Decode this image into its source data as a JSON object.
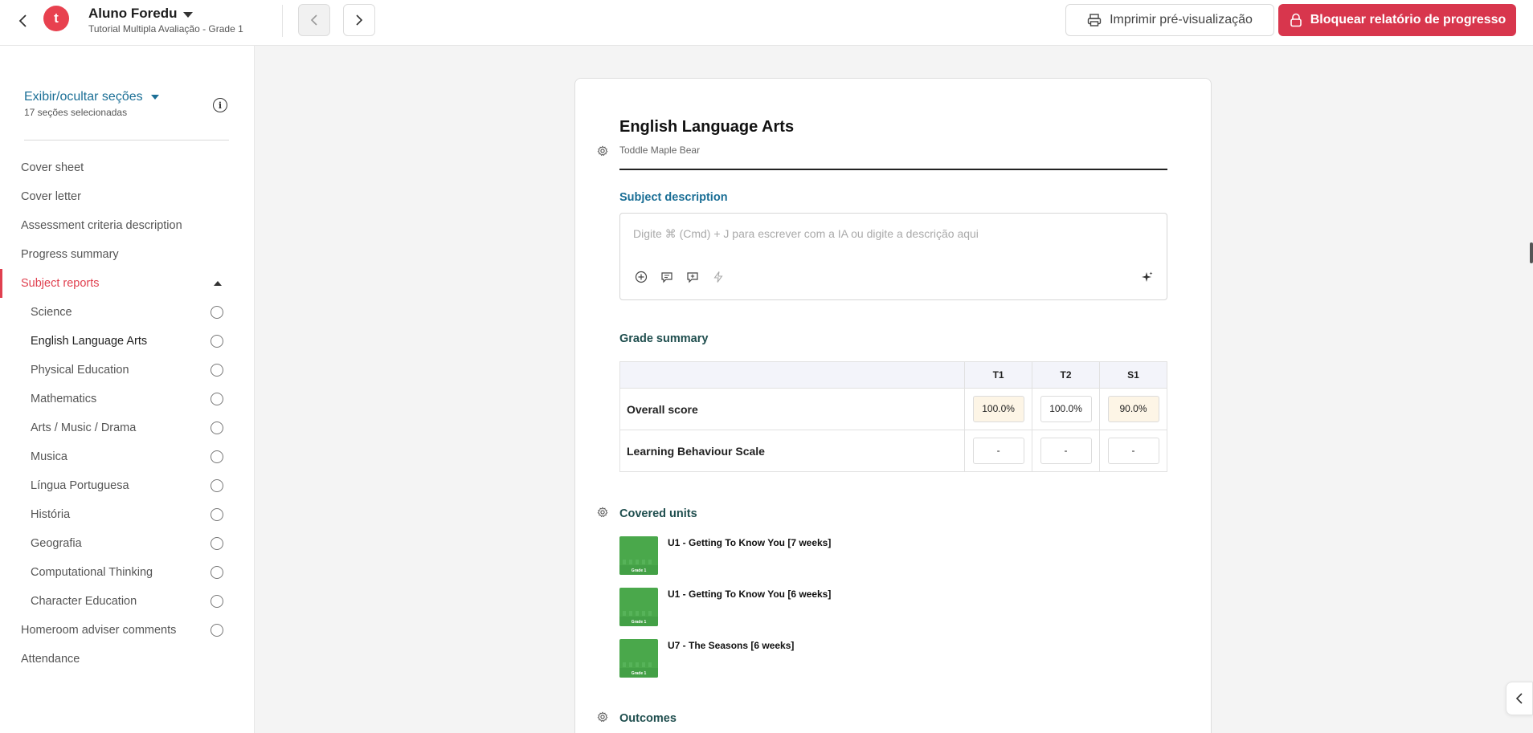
{
  "header": {
    "logo_letter": "t",
    "student_name": "Aluno Foredu",
    "student_subtitle": "Tutorial Multipla Avaliação - Grade 1",
    "print_label": "Imprimir pré-visualização",
    "lock_label": "Bloquear relatório de progresso",
    "accent_color": "#d8364d"
  },
  "sidebar": {
    "toggle_label": "Exibir/ocultar seções",
    "sections_count": "17 seções selecionadas",
    "items": [
      {
        "label": "Cover sheet"
      },
      {
        "label": "Cover letter"
      },
      {
        "label": "Assessment criteria description"
      },
      {
        "label": "Progress summary"
      },
      {
        "label": "Subject reports"
      },
      {
        "label": "Science"
      },
      {
        "label": "English Language Arts"
      },
      {
        "label": "Physical Education"
      },
      {
        "label": "Mathematics"
      },
      {
        "label": "Arts / Music / Drama"
      },
      {
        "label": "Musica"
      },
      {
        "label": "Língua Portuguesa"
      },
      {
        "label": "História"
      },
      {
        "label": "Geografia"
      },
      {
        "label": "Computational Thinking"
      },
      {
        "label": "Character Education"
      },
      {
        "label": "Homeroom adviser comments"
      },
      {
        "label": "Attendance"
      }
    ]
  },
  "report": {
    "subject_title": "English Language Arts",
    "school_name": "Toddle Maple Bear",
    "description_label": "Subject description",
    "description_placeholder": "Digite ⌘ (Cmd) + J para escrever com a IA ou digite a descrição aqui",
    "grade_summary_label": "Grade summary",
    "grade_table": {
      "columns": [
        "T1",
        "T2",
        "S1"
      ],
      "rows": [
        {
          "label": "Overall score",
          "values": [
            "100.0%",
            "100.0%",
            "90.0%"
          ]
        },
        {
          "label": "Learning Behaviour Scale",
          "values": [
            "-",
            "-",
            "-"
          ]
        }
      ]
    },
    "covered_units_label": "Covered units",
    "units": [
      {
        "title": "U1 - Getting To Know You [7 weeks]",
        "thumb_text": "Grade 1"
      },
      {
        "title": "U1 - Getting To Know You [6 weeks]",
        "thumb_text": "Grade 1"
      },
      {
        "title": "U7 - The Seasons [6 weeks]",
        "thumb_text": "Grade 1"
      }
    ],
    "outcomes_label": "Outcomes"
  }
}
